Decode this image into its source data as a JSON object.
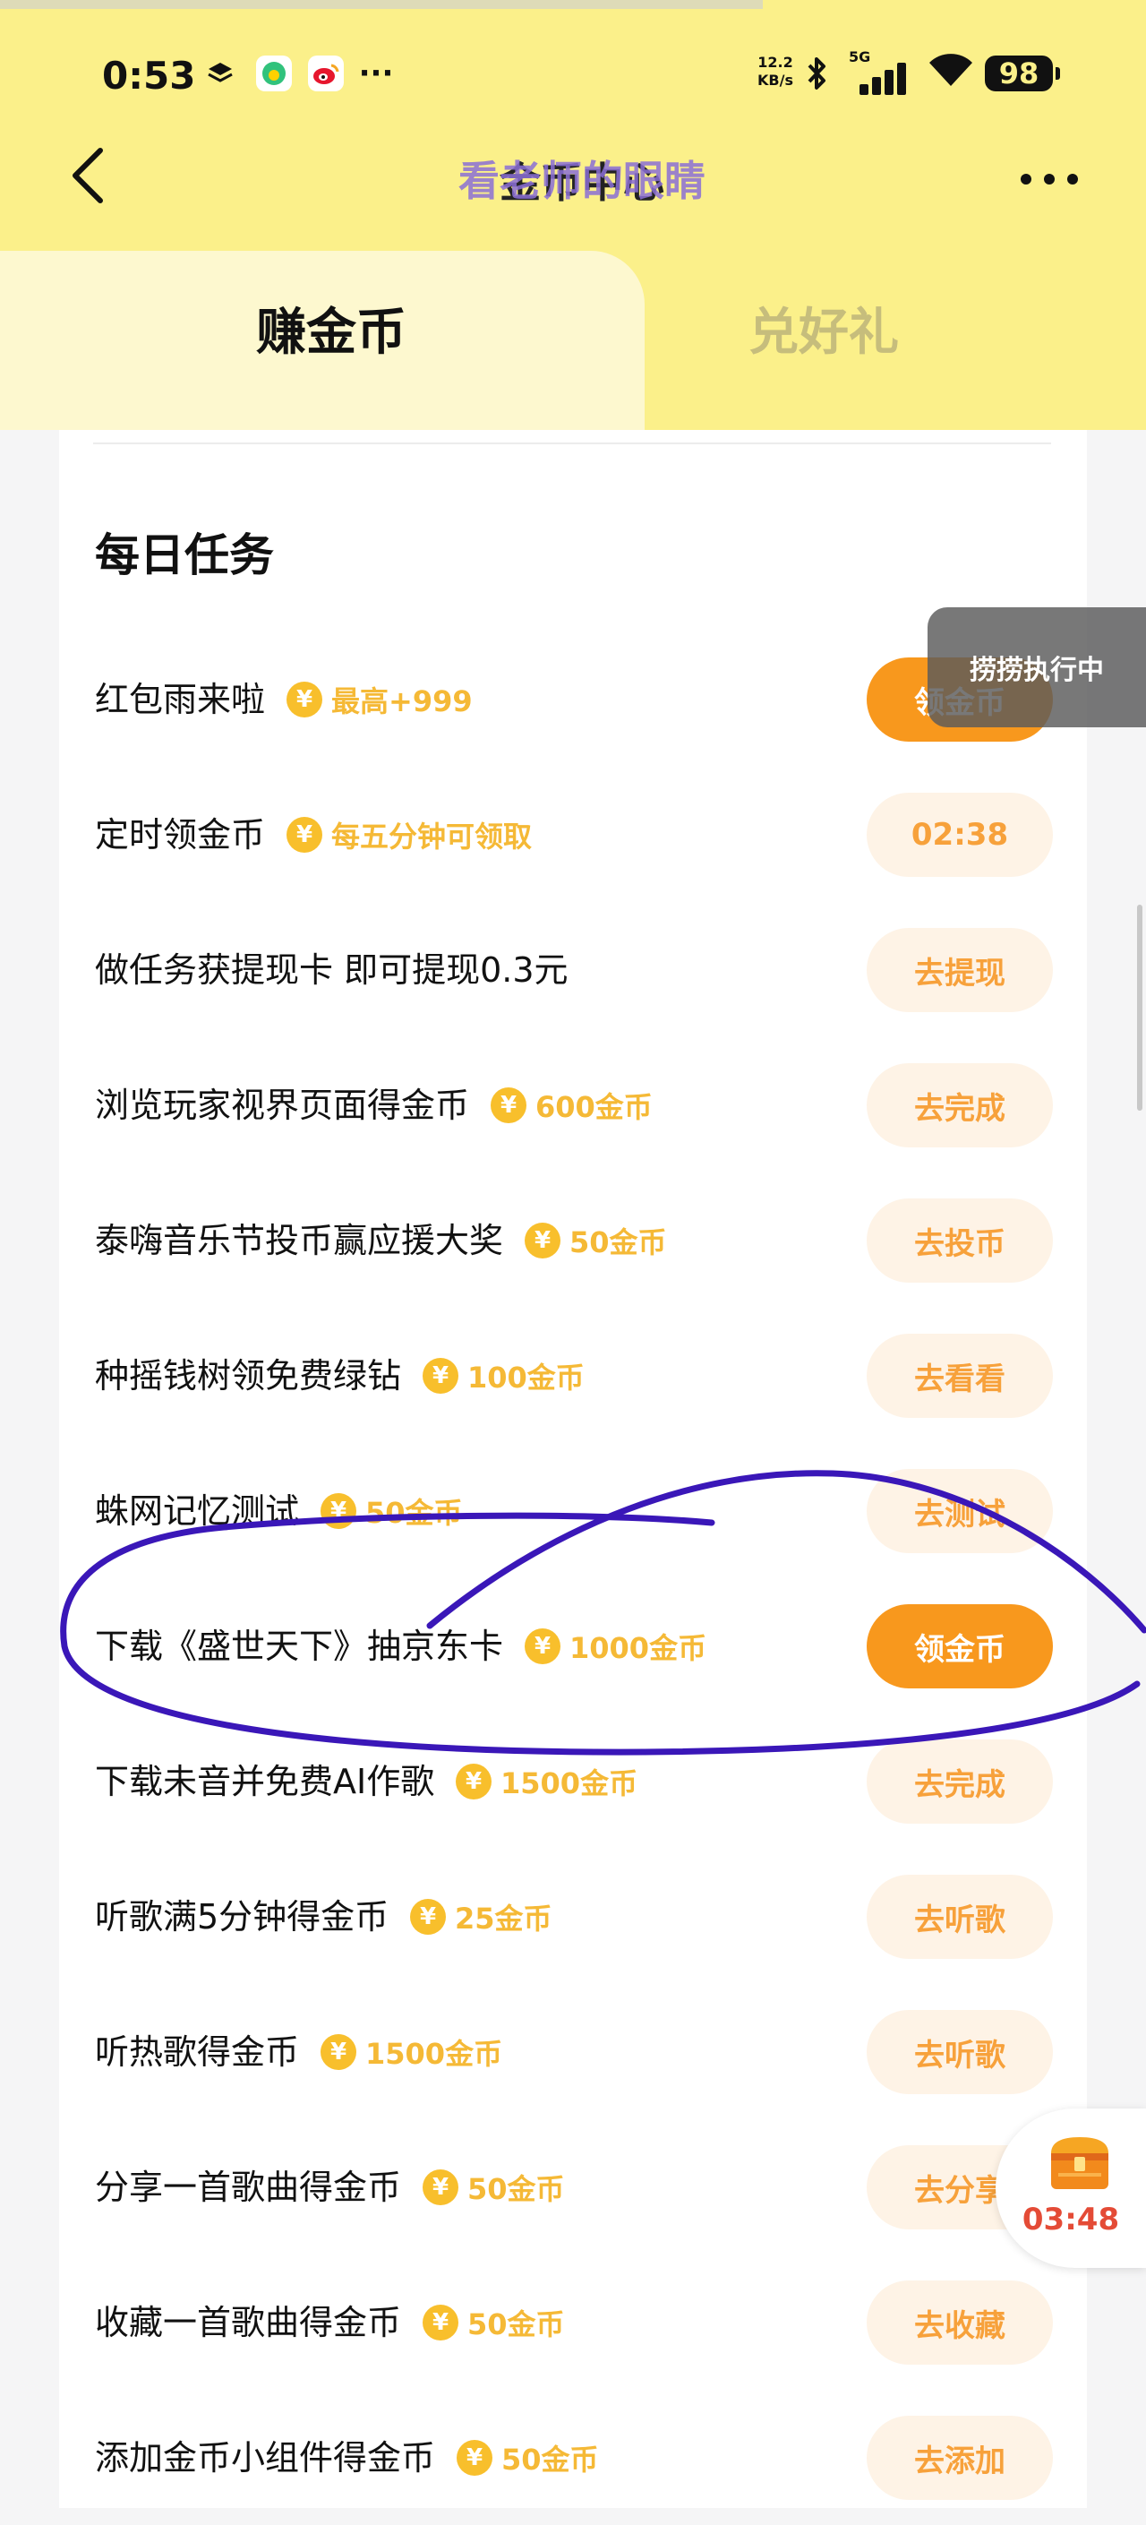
{
  "status_bar": {
    "time": "0:53",
    "network_speed_value": "12.2",
    "network_speed_unit": "KB/s",
    "network_type": "5G",
    "battery": "98",
    "more_notifications": "···"
  },
  "header": {
    "title": "金币中心",
    "overlay_text": "看老师的眼睛"
  },
  "tabs": [
    {
      "label": "赚金币",
      "active": true
    },
    {
      "label": "兑好礼",
      "active": false
    }
  ],
  "daily_tasks": {
    "title": "每日任务",
    "items": [
      {
        "title": "红包雨来啦",
        "reward": "最高+999",
        "button": "领金币",
        "primary": true
      },
      {
        "title": "定时领金币",
        "reward": "每五分钟可领取",
        "button": "02:38",
        "primary": false
      },
      {
        "title": "做任务获提现卡 即可提现0.3元",
        "reward": "",
        "button": "去提现",
        "primary": false
      },
      {
        "title": "浏览玩家视界页面得金币",
        "reward": "600金币",
        "button": "去完成",
        "primary": false
      },
      {
        "title": "泰嗨音乐节投币赢应援大奖",
        "reward": "50金币",
        "button": "去投币",
        "primary": false
      },
      {
        "title": "种摇钱树领免费绿钻",
        "reward": "100金币",
        "button": "去看看",
        "primary": false
      },
      {
        "title": "蛛网记忆测试",
        "reward": "50金币",
        "button": "去测试",
        "primary": false
      },
      {
        "title": "下载《盛世天下》抽京东卡",
        "reward": "1000金币",
        "button": "领金币",
        "primary": true
      },
      {
        "title": "下载未音并免费AI作歌",
        "reward": "1500金币",
        "button": "去完成",
        "primary": false
      },
      {
        "title": "听歌满5分钟得金币",
        "reward": "25金币",
        "button": "去听歌",
        "primary": false
      },
      {
        "title": "听热歌得金币",
        "reward": "1500金币",
        "button": "去听歌",
        "primary": false
      },
      {
        "title": "分享一首歌曲得金币",
        "reward": "50金币",
        "button": "去分享",
        "primary": false
      },
      {
        "title": "收藏一首歌曲得金币",
        "reward": "50金币",
        "button": "去收藏",
        "primary": false
      },
      {
        "title": "添加金币小组件得金币",
        "reward": "50金币",
        "button": "去添加",
        "primary": false
      }
    ]
  },
  "toast": "捞捞执行中",
  "floating_chest": {
    "timer": "03:48"
  },
  "coin_symbol": "¥",
  "colors": {
    "header_bg": "#fbf08a",
    "accent_orange": "#f8981d",
    "reward_gold": "#f5b936",
    "annotation_purple": "#3a17b8"
  }
}
